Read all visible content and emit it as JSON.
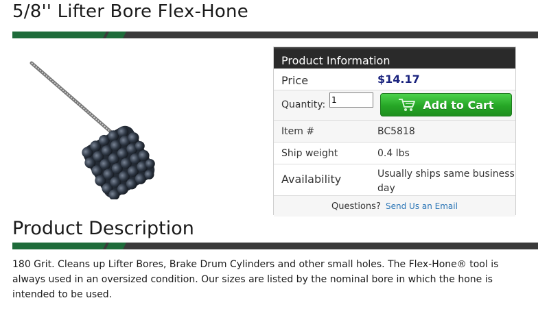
{
  "page": {
    "title": "5/8'' Lifter Bore Flex-Hone"
  },
  "product_info": {
    "header": "Product Information",
    "price_label": "Price",
    "price_value": "$14.17",
    "quantity_label": "Quantity:",
    "quantity_value": "1",
    "add_to_cart_label": "Add to Cart",
    "item_label": "Item #",
    "item_value": "BC5818",
    "ship_weight_label": "Ship weight",
    "ship_weight_value": "0.4 lbs",
    "availability_label": "Availability",
    "availability_value": "Usually ships same business day",
    "questions_label": "Questions?",
    "questions_link": "Send Us an Email"
  },
  "description": {
    "heading": "Product Description",
    "text": "180 Grit. Cleans up Lifter Bores, Brake Drum Cylinders and other small holes. The Flex-Hone® tool is always used in an oversized condition. Our sizes are listed by the nominal bore in which the hone is intended to be used."
  },
  "colors": {
    "accent_green": "#1e6b3a",
    "divider_dark": "#3a3a3a",
    "price_color": "#1a237e",
    "button_green": "#2bb02b",
    "link_color": "#2a75b6"
  },
  "icons": {
    "cart": "shopping-cart-icon"
  }
}
